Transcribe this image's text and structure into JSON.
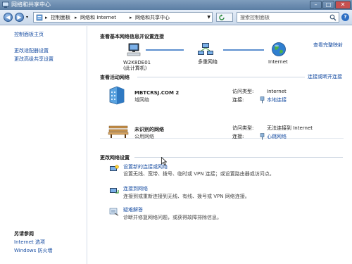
{
  "window": {
    "title": "网络和共享中心"
  },
  "address": {
    "crumbs": [
      "控制面板",
      "网络和 Internet",
      "网络和共享中心"
    ],
    "search_placeholder": "搜索控制面板"
  },
  "sidebar": {
    "items": [
      {
        "label": "控制面板主页"
      },
      {
        "label": "更改适配器设置"
      },
      {
        "label": "更改高级共享设置"
      }
    ],
    "see_also_title": "另请参阅",
    "see_also": [
      {
        "label": "Internet 选项"
      },
      {
        "label": "Windows 防火墙"
      }
    ]
  },
  "main": {
    "map_heading": "查看基本网络信息并设置连接",
    "view_full_map": "查看完整映射",
    "map_nodes": [
      {
        "name": "W2K8DE01",
        "sub": "(此计算机)"
      },
      {
        "name": "多重网络",
        "sub": ""
      },
      {
        "name": "Internet",
        "sub": ""
      }
    ],
    "active_heading": "查看活动网络",
    "connect_disconnect": "连接或断开连接",
    "networks": [
      {
        "name": "MBTCRSJ.COM  2",
        "type": "域网络",
        "access_label": "访问类型:",
        "access_value": "Internet",
        "conn_label": "连接:",
        "conn_value": "本地连接"
      },
      {
        "name": "未识别的网络",
        "type": "公用网络",
        "access_label": "访问类型:",
        "access_value": "无法连接到 Internet",
        "conn_label": "连接:",
        "conn_value": "心跳网络"
      }
    ],
    "change_heading": "更改网络设置",
    "tasks": [
      {
        "title": "设置新的连接或网络",
        "desc": "设置无线、宽带、拨号、临时或 VPN 连接；或设置路由器或访问点。"
      },
      {
        "title": "连接到网络",
        "desc": "连接到或重新连接到无线、有线、拨号或 VPN 网络连接。"
      },
      {
        "title": "疑难解答",
        "desc": "诊断并修复网络问题，或获得故障排除信息。"
      }
    ]
  },
  "colors": {
    "link": "#1a4fa3",
    "titlebar": "#5b7ea4"
  }
}
